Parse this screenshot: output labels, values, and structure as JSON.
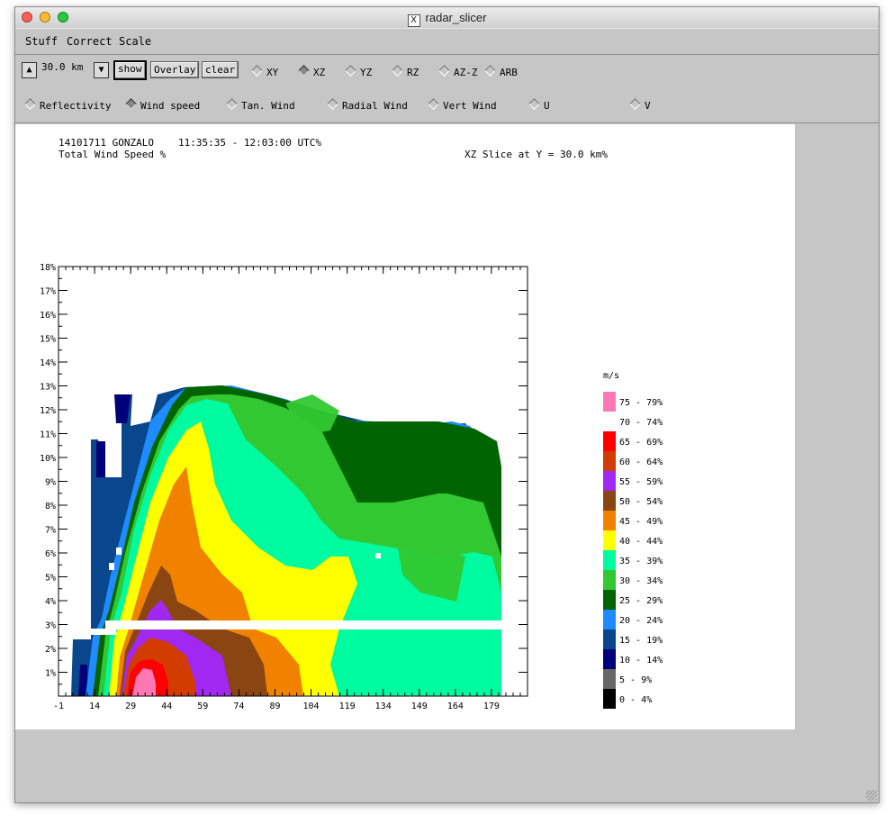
{
  "window": {
    "title": "radar_slicer",
    "logo_glyph": "X"
  },
  "menu": [
    "Stuff",
    "Correct",
    "Scale"
  ],
  "toolbar": {
    "up_glyph": "▲",
    "down_glyph": "▼",
    "distance": "30.0 km",
    "show_label": "show",
    "overlay_label": "Overlay",
    "clear_label": "clear",
    "slice_modes": [
      {
        "label": "XY",
        "selected": false
      },
      {
        "label": "XZ",
        "selected": true
      },
      {
        "label": "YZ",
        "selected": false
      },
      {
        "label": "RZ",
        "selected": false
      },
      {
        "label": "AZ-Z",
        "selected": false
      },
      {
        "label": "ARB",
        "selected": false
      }
    ],
    "fields": [
      {
        "label": "Reflectivity",
        "selected": false
      },
      {
        "label": "Wind speed",
        "selected": true
      },
      {
        "label": "Tan. Wind",
        "selected": false
      },
      {
        "label": "Radial Wind",
        "selected": false
      },
      {
        "label": "Vert Wind",
        "selected": false
      },
      {
        "label": "U",
        "selected": false
      },
      {
        "label": "V",
        "selected": false
      }
    ]
  },
  "plot_header": {
    "storm_id": "14101711 GONZALO",
    "time_range": "11:35:35 - 12:03:00 UTC%",
    "field": "Total Wind Speed %",
    "slice": "XZ Slice at Y = 30.0 km%"
  },
  "chart_data": {
    "type": "heatmap",
    "x_ticks": [
      "-1",
      "14",
      "29",
      "44",
      "59",
      "74",
      "89",
      "104",
      "119",
      "134",
      "149",
      "164",
      "179"
    ],
    "y_ticks": [
      "1%",
      "2%",
      "3%",
      "4%",
      "5%",
      "6%",
      "7%",
      "8%",
      "9%",
      "10%",
      "11%",
      "12%",
      "13%",
      "14%",
      "15%",
      "16%",
      "17%",
      "18%"
    ],
    "xlim": [
      -1,
      194
    ],
    "ylim": [
      0,
      18
    ],
    "legend_unit": "m/s",
    "legend_position": "right",
    "legend": [
      {
        "label": "75 - 79%",
        "color": "#ff78b4"
      },
      {
        "label": "70 - 74%",
        "color": "#ffffff"
      },
      {
        "label": "65 - 69%",
        "color": "#ff0000"
      },
      {
        "label": "60 - 64%",
        "color": "#d23c00"
      },
      {
        "label": "55 - 59%",
        "color": "#a028f0"
      },
      {
        "label": "50 - 54%",
        "color": "#8b4513"
      },
      {
        "label": "45 - 49%",
        "color": "#f08200"
      },
      {
        "label": "40 - 44%",
        "color": "#ffff00"
      },
      {
        "label": "35 - 39%",
        "color": "#00faa0"
      },
      {
        "label": "30 - 34%",
        "color": "#32c832"
      },
      {
        "label": "25 - 29%",
        "color": "#006400"
      },
      {
        "label": "20 - 24%",
        "color": "#1e8cff"
      },
      {
        "label": "15 - 19%",
        "color": "#0a468c"
      },
      {
        "label": "10 - 14%",
        "color": "#000078"
      },
      {
        "label": "5 - 9%",
        "color": "#666666"
      },
      {
        "label": "0 - 4%",
        "color": "#000000"
      }
    ]
  }
}
